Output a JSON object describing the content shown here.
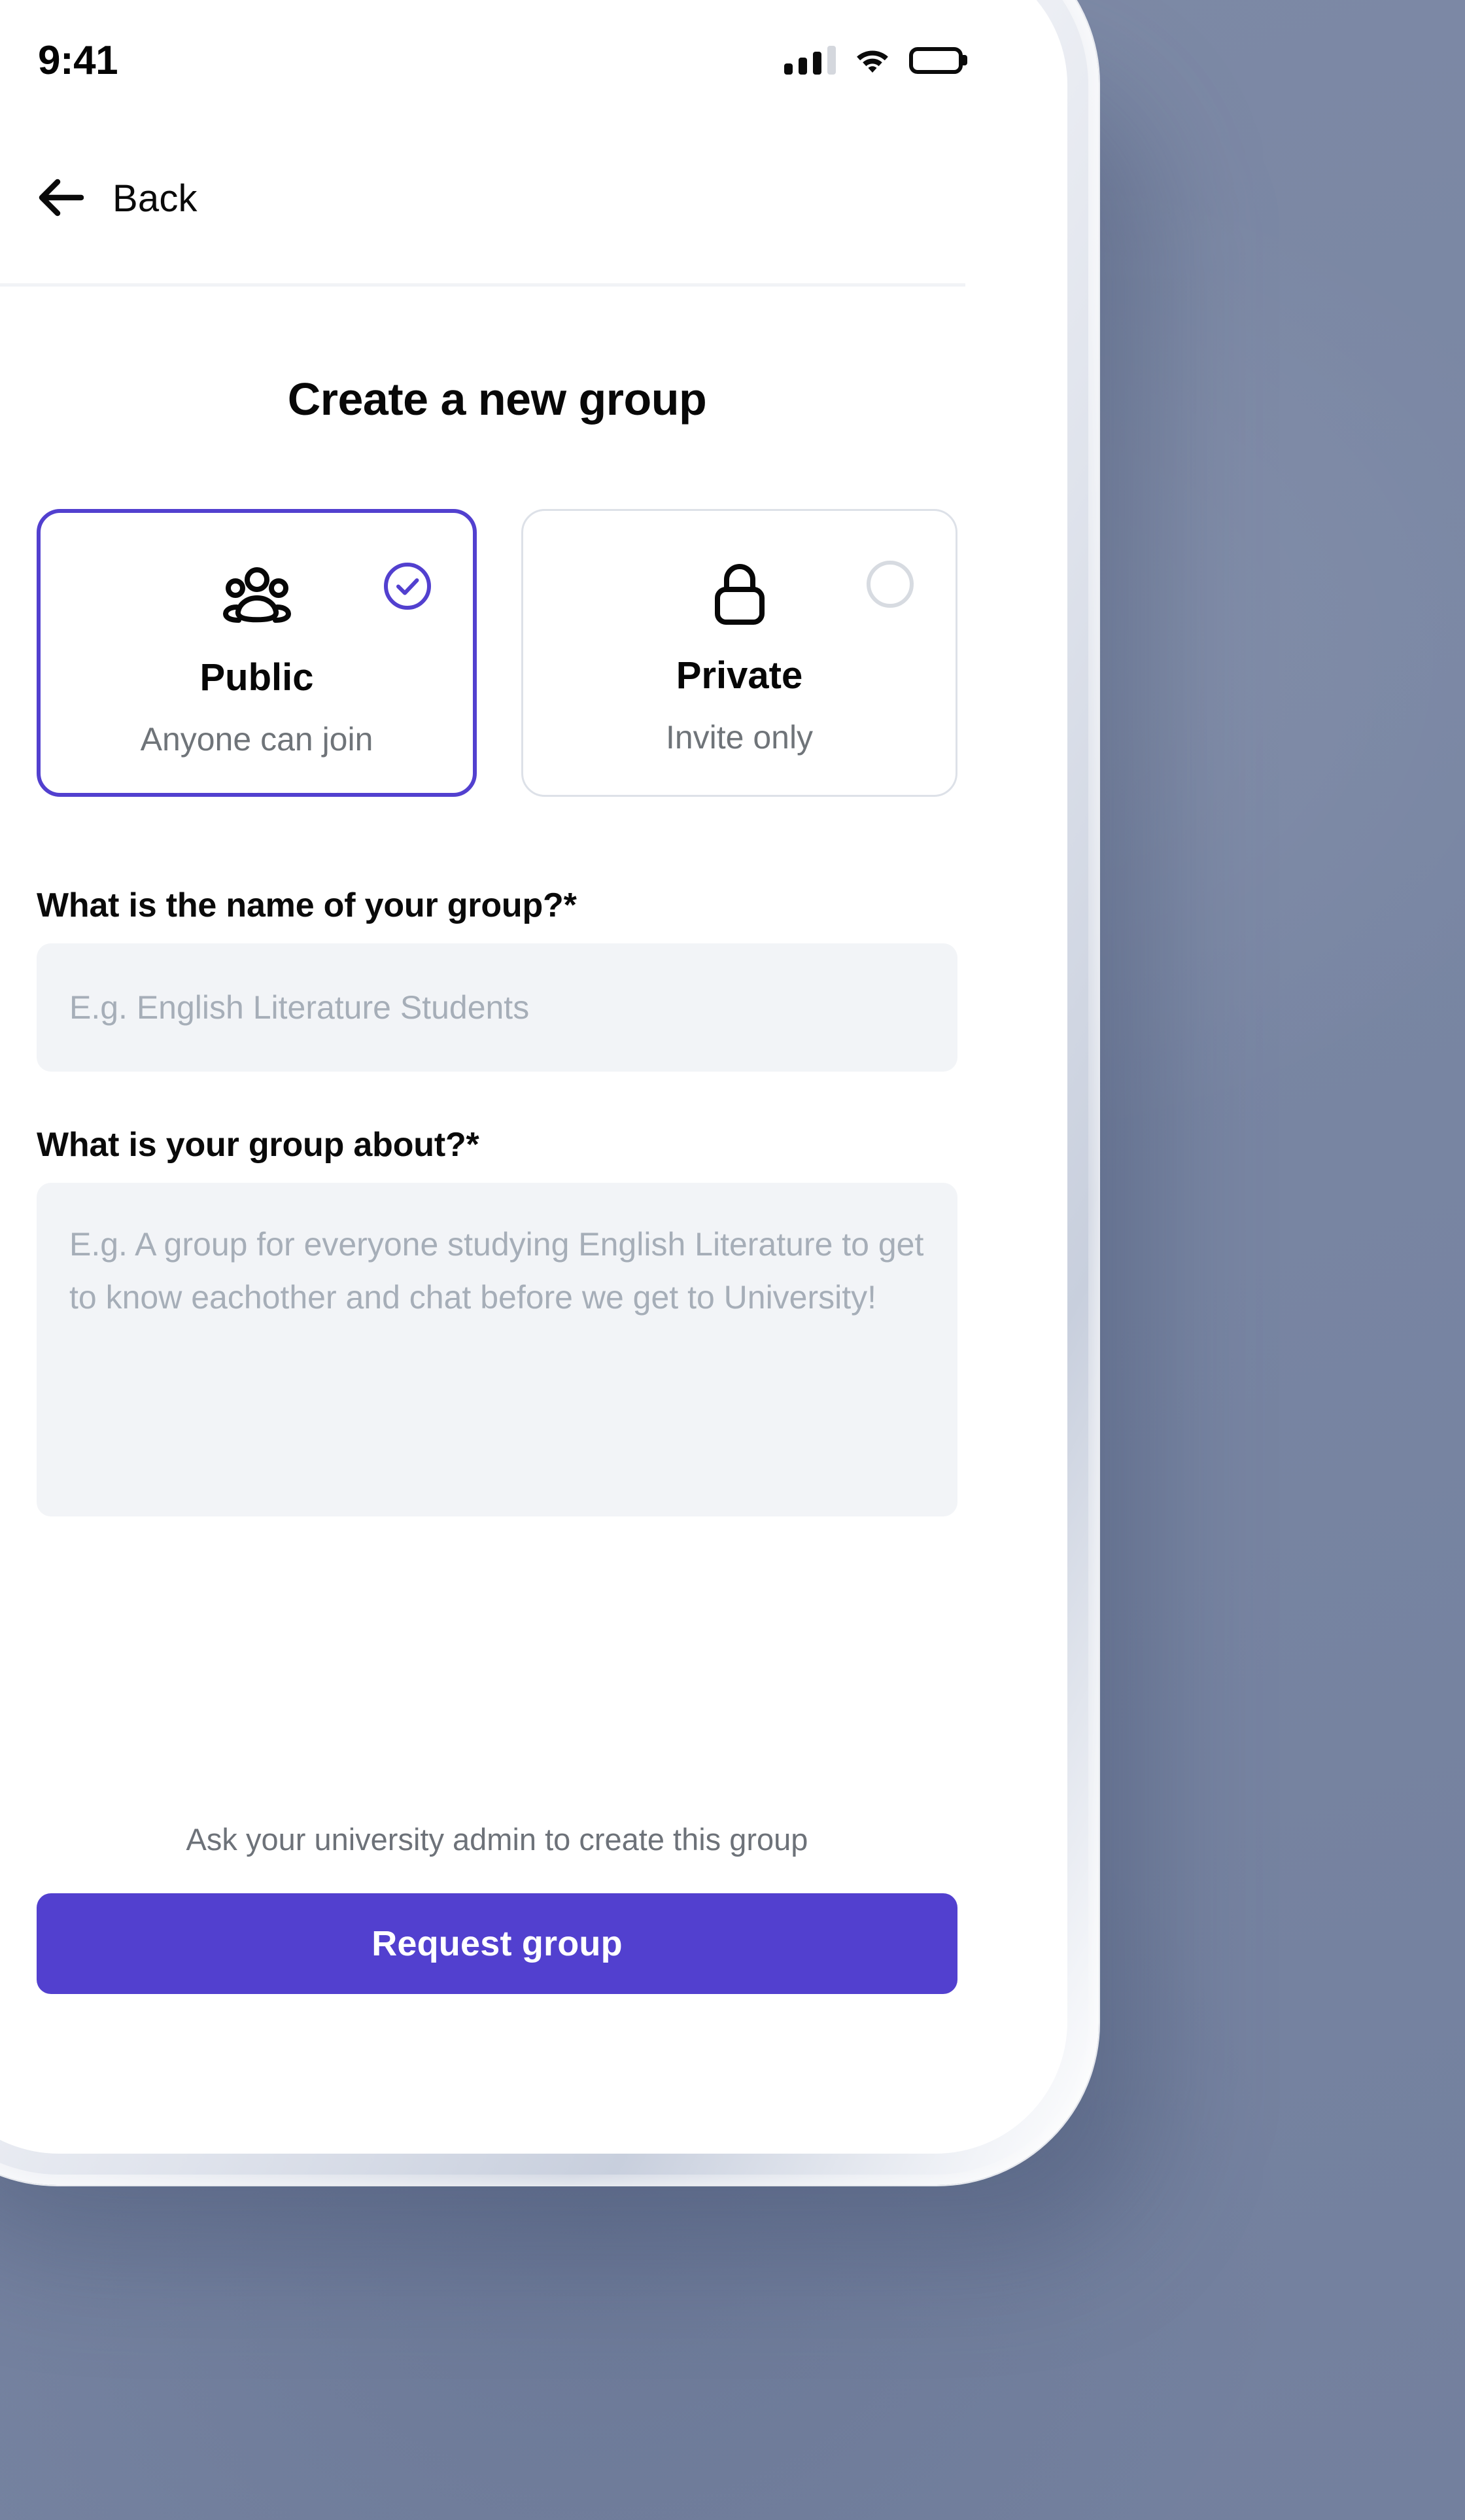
{
  "status_bar": {
    "time": "9:41",
    "signal_icon": "cellular-signal-icon",
    "wifi_icon": "wifi-icon",
    "battery_icon": "battery-full-icon"
  },
  "nav": {
    "back_label": "Back",
    "back_icon": "arrow-left-icon"
  },
  "page": {
    "title": "Create a new group"
  },
  "privacy_options": [
    {
      "id": "public",
      "icon": "users-group-icon",
      "title": "Public",
      "subtitle": "Anyone can join",
      "selected": true,
      "radio_icon": "check-circle-icon"
    },
    {
      "id": "private",
      "icon": "lock-icon",
      "title": "Private",
      "subtitle": "Invite only",
      "selected": false,
      "radio_icon": "empty-circle-icon"
    }
  ],
  "form": {
    "name_field": {
      "label": "What is the name of your group?*",
      "placeholder": "E.g. English Literature Students",
      "value": ""
    },
    "about_field": {
      "label": "What is your group about?*",
      "placeholder": "E.g. A group for everyone studying English Literature to get to know eachother and chat before we get to University!",
      "value": ""
    }
  },
  "footer": {
    "note": "Ask your university admin to create this group",
    "button_label": "Request group"
  },
  "colors": {
    "accent": "#5240CF",
    "background": "#7B88A4",
    "field_background": "#F2F4F7",
    "placeholder": "#A6AEB8",
    "muted_text": "#6D7279",
    "card_border": "#DDE1E8"
  }
}
